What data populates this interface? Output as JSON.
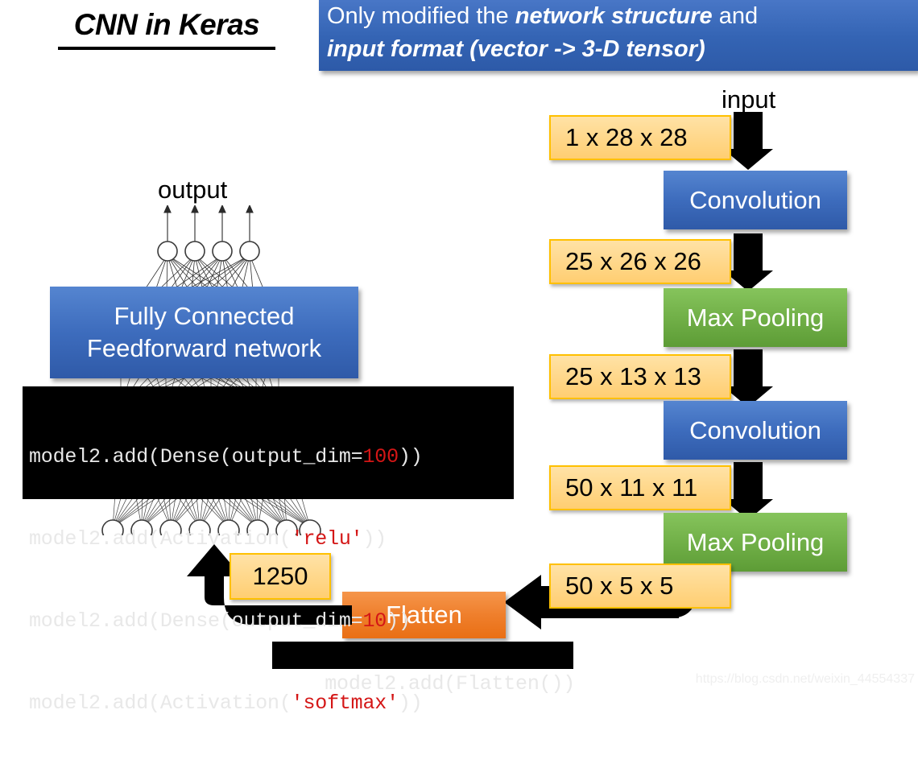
{
  "slide": {
    "title": "CNN in Keras",
    "banner": {
      "line1_pre": "Only modified the ",
      "line1_em": "network structure",
      "line1_post": " and",
      "line2": "input format (vector -> 3-D tensor)"
    },
    "watermark": "https://blog.csdn.net/weixin_44554337"
  },
  "labels": {
    "input": "input",
    "output": "output"
  },
  "pipeline": {
    "tensors": [
      {
        "id": "t1",
        "label": "1 x 28 x 28"
      },
      {
        "id": "t2",
        "label": "25 x 26 x 26"
      },
      {
        "id": "t3",
        "label": "25 x 13 x 13"
      },
      {
        "id": "t4",
        "label": "50 x 11 x 11"
      },
      {
        "id": "t5",
        "label": "50 x 5 x 5"
      },
      {
        "id": "t6",
        "label": "1250"
      }
    ],
    "ops": [
      {
        "id": "conv1",
        "label": "Convolution",
        "color": "#3d6cbd"
      },
      {
        "id": "pool1",
        "label": "Max Pooling",
        "color": "#6fae46"
      },
      {
        "id": "conv2",
        "label": "Convolution",
        "color": "#3d6cbd"
      },
      {
        "id": "pool2",
        "label": "Max Pooling",
        "color": "#6fae46"
      },
      {
        "id": "flatten",
        "label": "Flatten",
        "color": "#ef7f2c"
      }
    ]
  },
  "fully_connected": {
    "line1": "Fully Connected",
    "line2": "Feedforward network"
  },
  "code_dense": {
    "lines": [
      {
        "pre": "model2.add(Dense(output_dim=",
        "hl": "100",
        "post": "))"
      },
      {
        "pre": "model2.add(Activation(",
        "hl": "'relu'",
        "post": "))"
      },
      {
        "pre": "model2.add(Dense(output_dim=",
        "hl": "10",
        "post": "))"
      },
      {
        "pre": "model2.add(Activation(",
        "hl": "'softmax'",
        "post": "))"
      }
    ]
  },
  "code_flatten": {
    "line": "model2.add(Flatten())"
  },
  "colors": {
    "tensor_fill": "#ffd88c",
    "tensor_border": "#ffc000",
    "blue": "#3d6cbd",
    "green": "#6fae46",
    "orange": "#ef7f2c",
    "banner": "#3464b4",
    "code_bg": "#000000",
    "code_highlight": "#d41616"
  }
}
